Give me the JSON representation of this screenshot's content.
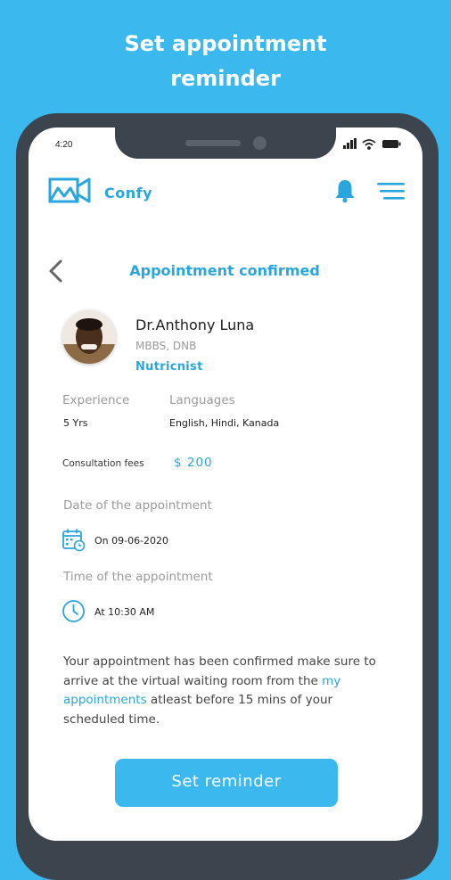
{
  "headline": {
    "line1": "Set appointment",
    "line2": "reminder"
  },
  "status_bar": {
    "time": "4:20"
  },
  "app": {
    "name": "Confy"
  },
  "screen": {
    "title": "Appointment confirmed"
  },
  "doctor": {
    "name": "Dr.Anthony Luna",
    "degree": "MBBS, DNB",
    "specialty": "Nutricnist",
    "experience_label": "Experience",
    "experience_value": "5 Yrs",
    "languages_label": "Languages",
    "languages_value": "English, Hindi, Kanada",
    "fees_label": "Consultation fees",
    "fees_value": "$ 200"
  },
  "appointment": {
    "date_label": "Date of the appointment",
    "date_value": "On 09-06-2020",
    "time_label": "Time of the appointment",
    "time_value": "At 10:30 AM"
  },
  "note": {
    "part1": "Your appointment has been confirmed make sure to arrive at the virtual waiting room from the ",
    "link": "my appointments",
    "part2": "  atleast before 15 mins of your scheduled time."
  },
  "actions": {
    "reminder_label": "Set reminder"
  },
  "icons": {
    "logo": "video-camera-logo-icon",
    "notifications": "bell-icon",
    "menu": "hamburger-menu-icon",
    "back": "chevron-left-icon",
    "date": "calendar-icon",
    "time": "clock-icon",
    "signal": "signal-icon",
    "wifi": "wifi-icon",
    "battery": "battery-icon"
  },
  "colors": {
    "background": "#3bb8ee",
    "accent": "#2aa6df",
    "phone_frame": "#3c444d",
    "text_grey": "#9a9a9a"
  }
}
